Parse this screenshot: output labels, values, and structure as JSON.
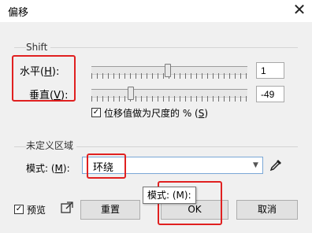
{
  "window": {
    "title": "偏移",
    "close_icon": "close-icon"
  },
  "shift_group": {
    "label": "Shift",
    "horizontal": {
      "label": "水平",
      "accel": "H",
      "suffix": "):",
      "value": "1",
      "slider_level": 0.49
    },
    "vertical": {
      "label": "垂直",
      "accel": "V",
      "suffix": "):",
      "value": "-49",
      "slider_level": 0.25
    },
    "percent_checkbox": {
      "label": "位移值做为尺度的 % ",
      "accel": "S",
      "checked": true
    }
  },
  "undefined_region": {
    "label": "未定义区域",
    "mode_label": "模式:",
    "mode_accel": "M",
    "mode_value": "环绕",
    "eyedropper_icon": "eyedropper-icon"
  },
  "tooltip": {
    "text": "模式: (M):"
  },
  "footer": {
    "preview_label": "预览",
    "preview_checked": true,
    "popout_icon": "popout-icon",
    "reset_label": "重置",
    "ok_label": "OK",
    "cancel_label": "取消"
  },
  "colors": {
    "highlight": "#e02020",
    "accent": "#7aa7d6"
  }
}
